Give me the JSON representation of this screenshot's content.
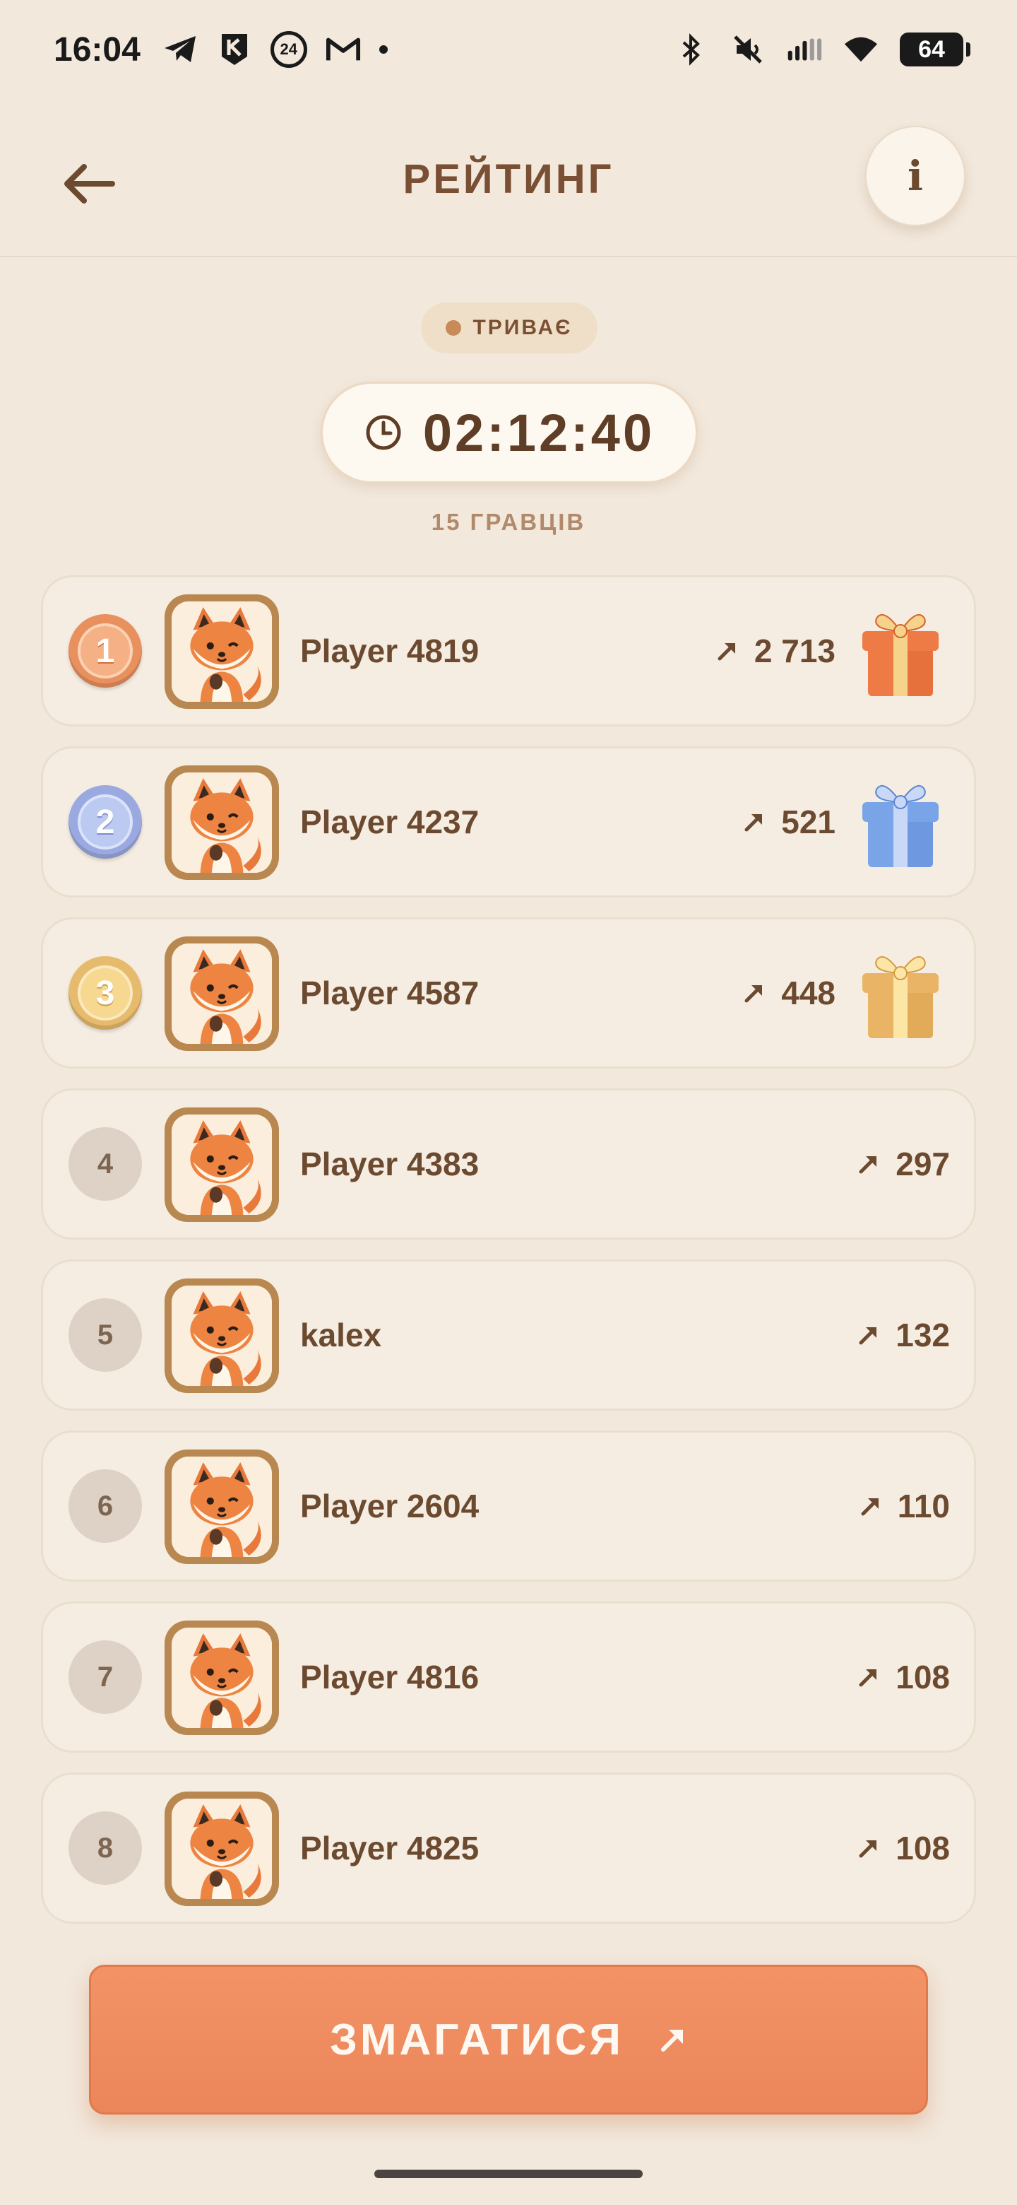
{
  "status_bar": {
    "time": "16:04",
    "left_icons": [
      "telegram-icon",
      "kyivstar-icon",
      "channel-24-icon",
      "gmail-icon",
      "notification-dot-icon"
    ],
    "channel_badge": "24",
    "right_icons": [
      "bluetooth-icon",
      "mute-icon",
      "signal-icon",
      "wifi-icon",
      "battery-icon"
    ],
    "battery": "64"
  },
  "header": {
    "title": "РЕЙТИНГ",
    "back_icon": "arrow-left-icon",
    "info_label": "i"
  },
  "contest": {
    "status": "ТРИВАЄ",
    "timer": "02:12:40",
    "players_count": "15 ГРАВЦІВ"
  },
  "leaderboard": [
    {
      "rank": "1",
      "name": "Player 4819",
      "score": "2 713",
      "medal": "gold-1",
      "gift": "orange"
    },
    {
      "rank": "2",
      "name": "Player 4237",
      "score": "521",
      "medal": "silver-2",
      "gift": "blue"
    },
    {
      "rank": "3",
      "name": "Player 4587",
      "score": "448",
      "medal": "bronze-3",
      "gift": "gold"
    },
    {
      "rank": "4",
      "name": "Player 4383",
      "score": "297",
      "medal": null,
      "gift": null
    },
    {
      "rank": "5",
      "name": "kalex",
      "score": "132",
      "medal": null,
      "gift": null
    },
    {
      "rank": "6",
      "name": "Player 2604",
      "score": "110",
      "medal": null,
      "gift": null
    },
    {
      "rank": "7",
      "name": "Player 4816",
      "score": "108",
      "medal": null,
      "gift": null
    },
    {
      "rank": "8",
      "name": "Player 4825",
      "score": "108",
      "medal": null,
      "gift": null
    }
  ],
  "colors": {
    "background": "#f2e8dc",
    "text_brown": "#6b4a30",
    "accent_orange": "#eb865a",
    "gift_orange": "#ee7a45",
    "gift_blue": "#7aa4e8",
    "gift_gold": "#eab466"
  },
  "compete_button": {
    "label": "ЗМАГАТИСЯ",
    "icon": "arrow-up-right-icon"
  }
}
